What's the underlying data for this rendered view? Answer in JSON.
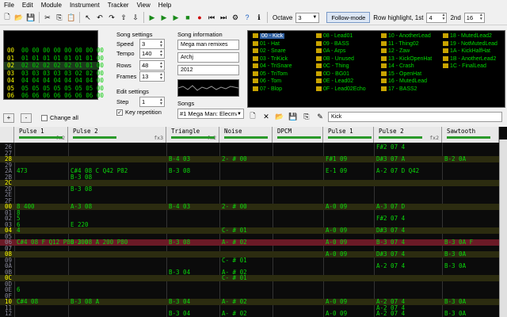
{
  "menu": [
    "File",
    "Edit",
    "Module",
    "Instrument",
    "Tracker",
    "View",
    "Help"
  ],
  "toolbar": {
    "octave_label": "Octave",
    "octave_value": "3",
    "follow_mode": "Follow-mode",
    "row_highlight_label": "Row highlight, 1st",
    "row_highlight_1st": "4",
    "second_label": "2nd",
    "row_highlight_2nd": "16"
  },
  "frames": {
    "rows": [
      {
        "n": "00",
        "cells": "00 00 00 00 00 00 00 00"
      },
      {
        "n": "01",
        "cells": "01 01 01 01 01 01 01 00"
      },
      {
        "n": "02",
        "cells": "02 02 02 02 02 01 01 00"
      },
      {
        "n": "03",
        "cells": "03 03 03 03 03 02 02 00"
      },
      {
        "n": "04",
        "cells": "04 04 04 04 04 04 04 00"
      },
      {
        "n": "05",
        "cells": "05 05 05 05 05 05 05 00"
      },
      {
        "n": "06",
        "cells": "06 06 06 06 06 06 06 00"
      }
    ],
    "add": "+",
    "remove": "-",
    "change_all": "Change all"
  },
  "song_settings": {
    "title": "Song settings",
    "speed_label": "Speed",
    "speed": "3",
    "tempo_label": "Tempo",
    "tempo": "140",
    "rows_label": "Rows",
    "rows": "48",
    "frames_label": "Frames",
    "frames_value": "13",
    "edit_title": "Edit settings",
    "step_label": "Step",
    "step": "1",
    "key_repetition": "Key repetition"
  },
  "song_info": {
    "title": "Song information",
    "name": "Mega man remixes",
    "author": "Archj",
    "copyright": "2012",
    "songs_label": "Songs",
    "song_select": "#1 Mega Man: Elecma"
  },
  "instruments": {
    "col1": [
      "00 - Kick",
      "01 - Hat",
      "02 - Snare",
      "03 - TriKick",
      "04 - TriSnare",
      "05 - TriTom",
      "06 - Tom",
      "07 - Blop"
    ],
    "col2": [
      "08 - Lead01",
      "09 - BASS",
      "0A - Arps",
      "0B - Unused",
      "0C - Thing",
      "0D - BG01",
      "0E - Lead02",
      "0F - Lead02Echo"
    ],
    "col3": [
      "10 - AnotherLead",
      "11 - Thing02",
      "12 - Zaw",
      "13 - KickOpenHat",
      "14 - Crash",
      "15 - OpenHat",
      "16 - MutedLead",
      "17 - BASS2"
    ],
    "col4": [
      "18 - MutedLead2",
      "19 - NotMutedLead",
      "1A - KickHalfHat",
      "1B - AnotherLead2",
      "1C - FinalLead"
    ],
    "name_field": "Kick"
  },
  "channels": [
    {
      "name": "Pulse 1",
      "fx": "fx2"
    },
    {
      "name": "Pulse 2",
      "fx": "fx3"
    },
    {
      "name": "Triangle",
      "fx": "fx2"
    },
    {
      "name": "Noise",
      "fx": ""
    },
    {
      "name": "DPCM",
      "fx": ""
    },
    {
      "name": "Pulse 1",
      "fx": ""
    },
    {
      "name": "Pulse 2",
      "fx": "fx2"
    },
    {
      "name": "Sawtooth",
      "fx": ""
    }
  ],
  "pattern_rows": [
    {
      "n": "26",
      "c": [
        "",
        "",
        "",
        "",
        "",
        "",
        "F#2 07 4",
        "",
        ""
      ]
    },
    {
      "n": "27",
      "c": [
        "",
        "",
        "",
        "",
        "",
        "",
        "",
        "",
        ""
      ]
    },
    {
      "n": "28",
      "c": [
        "",
        "",
        "B-4 03",
        "2- # 00",
        "",
        "F#1 09",
        "D#3 07 A",
        "B-2 0A",
        ""
      ]
    },
    {
      "n": "29",
      "c": [
        "",
        "",
        "",
        "",
        "",
        "",
        "",
        "",
        ""
      ]
    },
    {
      "n": "2A",
      "c": [
        "473",
        "C#4 08 C Q42 P82",
        "B-3 08",
        "",
        "",
        "E-1 09",
        "A-2 07 D Q42",
        "",
        ""
      ]
    },
    {
      "n": "2B",
      "c": [
        "",
        "B-3 08",
        "",
        "",
        "",
        "",
        "",
        "",
        ""
      ]
    },
    {
      "n": "2C",
      "c": [
        "",
        "",
        "",
        "",
        "",
        "",
        "",
        "",
        ""
      ]
    },
    {
      "n": "2D",
      "c": [
        "",
        "B-3 08",
        "",
        "",
        "",
        "",
        "",
        "",
        ""
      ]
    },
    {
      "n": "2E",
      "c": [
        "",
        "",
        "",
        "",
        "",
        "",
        "",
        "",
        ""
      ]
    },
    {
      "n": "2F",
      "c": [
        "",
        "",
        "",
        "",
        "",
        "",
        "",
        "",
        ""
      ]
    },
    {
      "n": "00",
      "c": [
        "8 400",
        "A-3 08",
        "B-4 03",
        "2- # 00",
        "",
        "A-0 09",
        "A-3 07 D",
        "",
        ""
      ]
    },
    {
      "n": "01",
      "c": [
        "8",
        "",
        "",
        "",
        "",
        "",
        "",
        "",
        ""
      ]
    },
    {
      "n": "02",
      "c": [
        "5",
        "",
        "",
        "",
        "",
        "",
        "F#2 07 4",
        "",
        ""
      ]
    },
    {
      "n": "03",
      "c": [
        "6",
        "E 220",
        "",
        "",
        "",
        "",
        "",
        "",
        ""
      ]
    },
    {
      "n": "04",
      "c": [
        "4",
        "",
        "",
        "C- # 01",
        "",
        "A-0 09",
        "D#3 07 4",
        "",
        ""
      ]
    },
    {
      "n": "05",
      "c": [
        "",
        "",
        "",
        "",
        "",
        "",
        "",
        "",
        ""
      ]
    },
    {
      "n": "06",
      "c": [
        "C#4 08 F Q12 P80 200",
        "B-3 08 A 200 P80",
        "B-3 08",
        "A- # 02",
        "",
        "A-0 09",
        "B-3 07 4",
        "B-3 0A F",
        ""
      ]
    },
    {
      "n": "07",
      "c": [
        "",
        "",
        "",
        "",
        "",
        "",
        "",
        "",
        ""
      ]
    },
    {
      "n": "08",
      "c": [
        "",
        "",
        "",
        "",
        "",
        "A-0 09",
        "D#3 07 4",
        "B-3 0A",
        ""
      ]
    },
    {
      "n": "09",
      "c": [
        "",
        "",
        "",
        "C- # 01",
        "",
        "",
        "",
        "",
        ""
      ]
    },
    {
      "n": "0A",
      "c": [
        "",
        "",
        "",
        "",
        "",
        "",
        "A-2 07 4",
        "B-3 0A",
        ""
      ]
    },
    {
      "n": "0B",
      "c": [
        "",
        "",
        "B-3 04",
        "A- # 02",
        "",
        "",
        "",
        "",
        ""
      ]
    },
    {
      "n": "0C",
      "c": [
        "",
        "",
        "",
        "C- # 01",
        "",
        "",
        "",
        "",
        ""
      ]
    },
    {
      "n": "0D",
      "c": [
        "",
        "",
        "",
        "",
        "",
        "",
        "",
        "",
        ""
      ]
    },
    {
      "n": "0E",
      "c": [
        "6",
        "",
        "",
        "",
        "",
        "",
        "",
        "",
        ""
      ]
    },
    {
      "n": "0F",
      "c": [
        "",
        "",
        "",
        "",
        "",
        "",
        "",
        "",
        ""
      ]
    },
    {
      "n": "10",
      "c": [
        "C#4 08",
        "B-3 08 A",
        "B-3 04",
        "A- # 02",
        "",
        "A-0 09",
        "A-2 07 4",
        "B-3 0A",
        ""
      ]
    },
    {
      "n": "11",
      "c": [
        "",
        "",
        "",
        "",
        "",
        "",
        "A-2 07 4",
        "",
        ""
      ]
    },
    {
      "n": "12",
      "c": [
        "",
        "",
        "B-3 04",
        "A- # 02",
        "",
        "A-0 09",
        "A-2 07 4",
        "B-3 0A",
        ""
      ]
    }
  ],
  "colors": {
    "pattern_bg": "#0b0b0b",
    "note": "#0bd70b",
    "instrument": "#ff7f00",
    "highlight": "#2c2c10",
    "cursor_row": "#6b1a26",
    "row_number": "#ffff00"
  }
}
